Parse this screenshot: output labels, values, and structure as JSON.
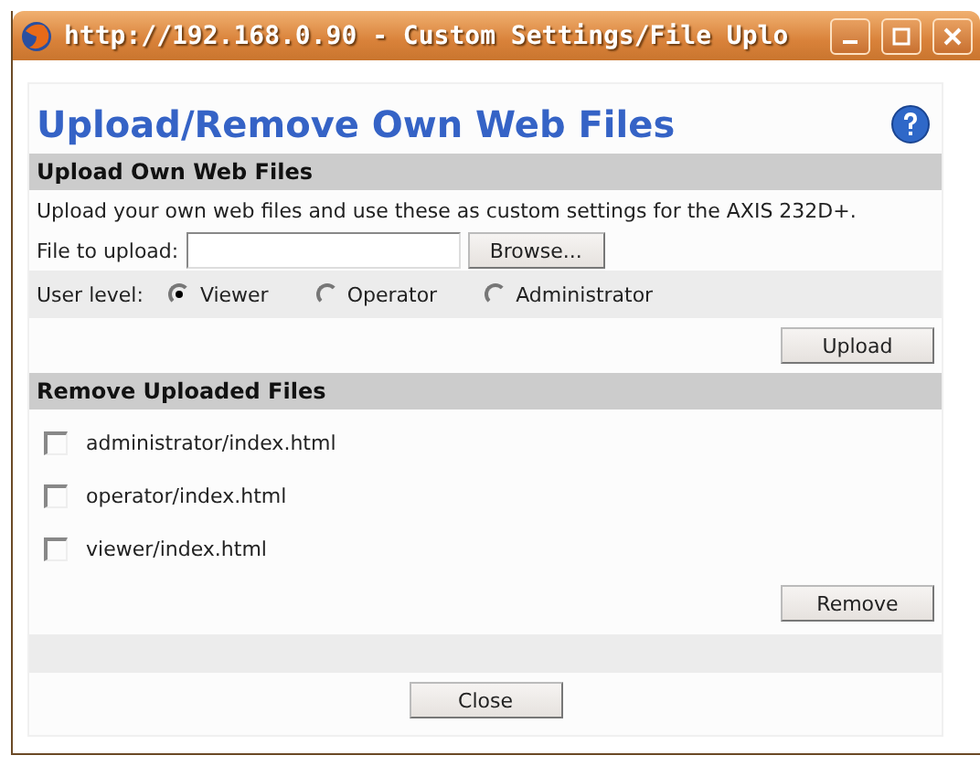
{
  "window": {
    "title": "http://192.168.0.90 - Custom Settings/File Uplo"
  },
  "page": {
    "heading": "Upload/Remove Own Web Files"
  },
  "upload_section": {
    "title": "Upload Own Web Files",
    "description": "Upload your own web files and use these as custom settings for the AXIS 232D+.",
    "file_label": "File to upload:",
    "browse_button": "Browse...",
    "user_level_label": "User level:",
    "user_levels": [
      {
        "label": "Viewer",
        "selected": true
      },
      {
        "label": "Operator",
        "selected": false
      },
      {
        "label": "Administrator",
        "selected": false
      }
    ],
    "upload_button": "Upload"
  },
  "remove_section": {
    "title": "Remove Uploaded Files",
    "files": [
      {
        "label": "administrator/index.html",
        "checked": false
      },
      {
        "label": "operator/index.html",
        "checked": false
      },
      {
        "label": "viewer/index.html",
        "checked": false
      }
    ],
    "remove_button": "Remove"
  },
  "close_button": "Close"
}
